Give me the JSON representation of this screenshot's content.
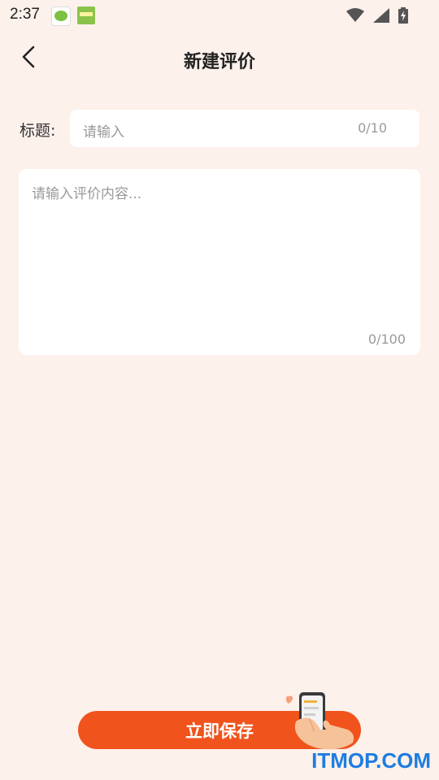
{
  "status_bar": {
    "time": "2:37",
    "icons": [
      "app-yc-icon",
      "app-green-icon",
      "wifi-icon",
      "signal-icon",
      "battery-charging-icon"
    ]
  },
  "header": {
    "title": "新建评价",
    "back_icon": "chevron-left-icon"
  },
  "form": {
    "title_label": "标题:",
    "title_placeholder": "请输入",
    "title_value": "",
    "title_counter": "0/10",
    "content_placeholder": "请输入评价内容...",
    "content_value": "",
    "content_counter": "0/100"
  },
  "footer": {
    "save_label": "立即保存",
    "illustration": "hand-holding-phone-icon"
  },
  "watermark": "ITMOP.COM",
  "colors": {
    "background": "#fdf1ec",
    "accent": "#f0531c",
    "watermark": "#1e7de0"
  }
}
